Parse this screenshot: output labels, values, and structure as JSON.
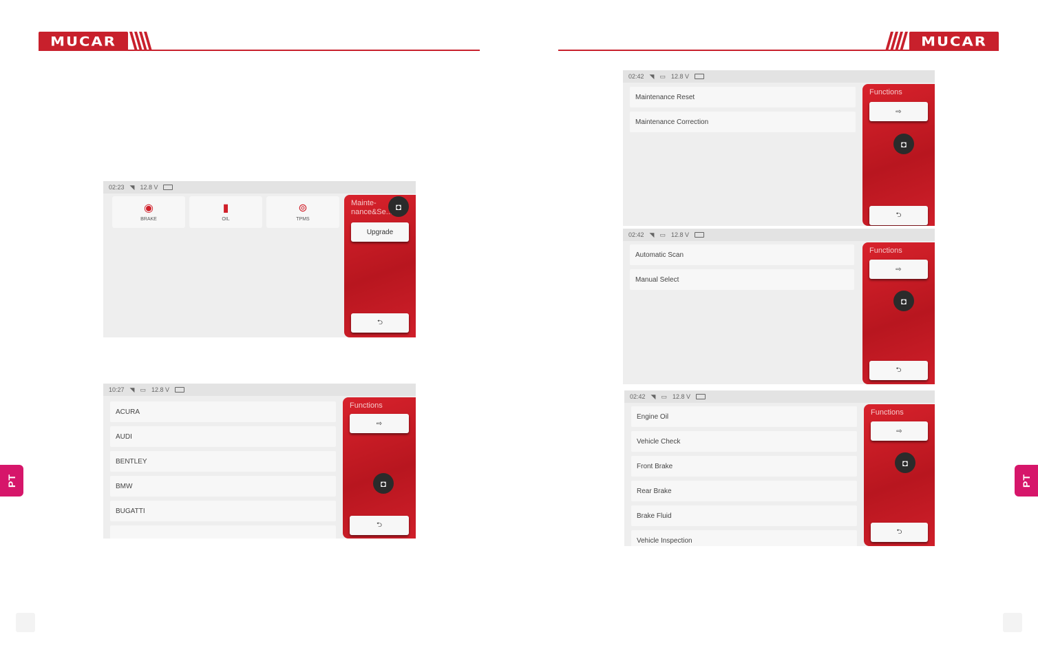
{
  "brand": {
    "name": "MUCAR",
    "accent": "#c8202c"
  },
  "side_tab_label": "PT",
  "shots": {
    "main_menu": {
      "status_time": "02:23",
      "voltage": "12.8 V",
      "tiles": [
        {
          "label": "BRAKE",
          "icon": "brake-icon"
        },
        {
          "label": "OIL",
          "icon": "oil-can-icon"
        },
        {
          "label": "TPMS",
          "icon": "tpms-icon"
        }
      ],
      "panel_title": "Mainte-nance&Se...",
      "upgrade_label": "Upgrade"
    },
    "brands": {
      "status_time": "10:27",
      "voltage": "12.8 V",
      "panel_title": "Functions",
      "items": [
        "ACURA",
        "AUDI",
        "BENTLEY",
        "BMW",
        "BUGATTI"
      ]
    },
    "maintenance": {
      "status_time": "02:42",
      "voltage": "12.8 V",
      "panel_title": "Functions",
      "items": [
        "Maintenance Reset",
        "Maintenance Correction"
      ]
    },
    "scan": {
      "status_time": "02:42",
      "voltage": "12.8 V",
      "panel_title": "Functions",
      "items": [
        "Automatic Scan",
        "Manual Select"
      ]
    },
    "checks": {
      "status_time": "02:42",
      "voltage": "12.8 V",
      "panel_title": "Functions",
      "items": [
        "Engine Oil",
        "Vehicle Check",
        "Front Brake",
        "Rear Brake",
        "Brake Fluid",
        "Vehicle Inspection"
      ]
    }
  }
}
